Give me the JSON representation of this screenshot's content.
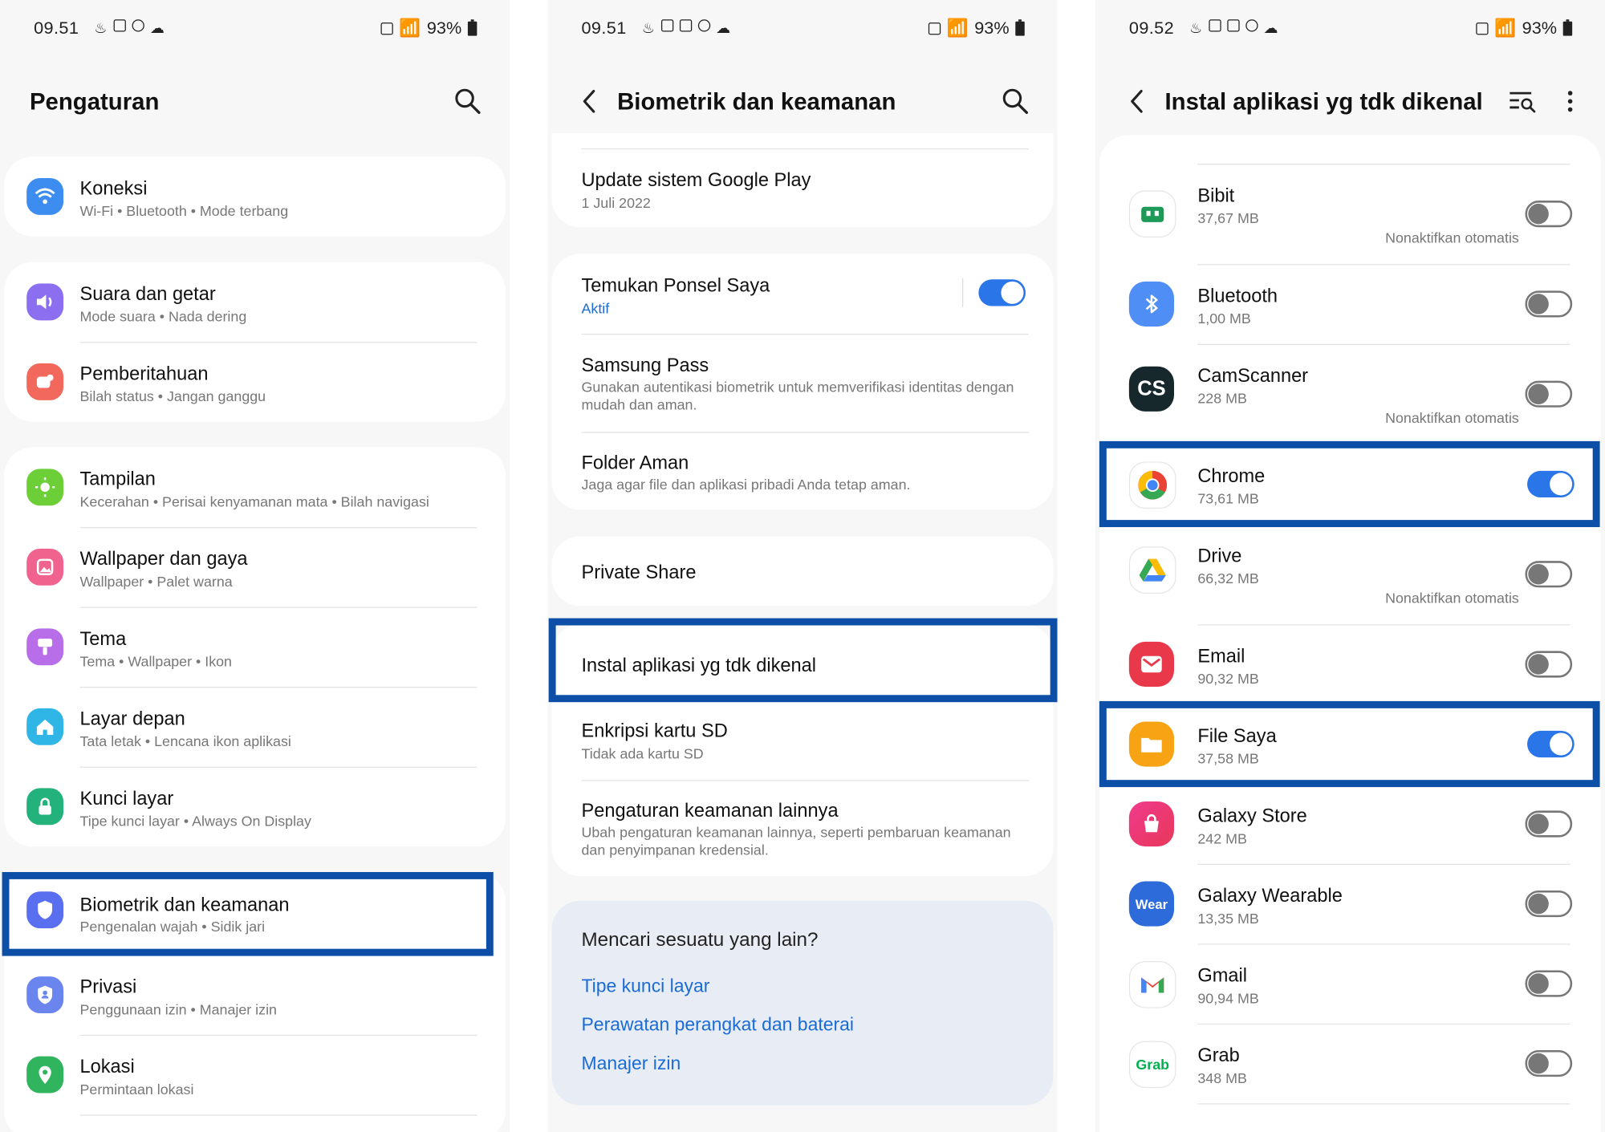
{
  "status": {
    "p1_time": "09.51",
    "p2_time": "09.51",
    "p3_time": "09.52",
    "battery": "93%"
  },
  "panel1": {
    "title": "Pengaturan",
    "items": [
      {
        "title": "Koneksi",
        "sub": "Wi-Fi  •  Bluetooth  •  Mode terbang",
        "color": "#3d8cf0"
      },
      {
        "title": "Suara dan getar",
        "sub": "Mode suara  •  Nada dering",
        "color": "#8b6ff0"
      },
      {
        "title": "Pemberitahuan",
        "sub": "Bilah status  •  Jangan ganggu",
        "color": "#f2685c"
      },
      {
        "title": "Tampilan",
        "sub": "Kecerahan  •  Perisai kenyamanan mata  •  Bilah navigasi",
        "color": "#6ccf38"
      },
      {
        "title": "Wallpaper dan gaya",
        "sub": "Wallpaper  •  Palet warna",
        "color": "#f0638e"
      },
      {
        "title": "Tema",
        "sub": "Tema  •  Wallpaper  •  Ikon",
        "color": "#b86ee8"
      },
      {
        "title": "Layar depan",
        "sub": "Tata letak  •  Lencana ikon aplikasi",
        "color": "#2fb5e6"
      },
      {
        "title": "Kunci layar",
        "sub": "Tipe kunci layar  •  Always On Display",
        "color": "#23b27c"
      },
      {
        "title": "Biometrik dan keamanan",
        "sub": "Pengenalan wajah  •  Sidik jari",
        "color": "#5a6ff0"
      },
      {
        "title": "Privasi",
        "sub": "Penggunaan izin  •  Manajer izin",
        "color": "#6a86ee"
      },
      {
        "title": "Lokasi",
        "sub": "Permintaan lokasi",
        "color": "#31b45e"
      }
    ]
  },
  "panel2": {
    "title": "Biometrik dan keamanan",
    "items": [
      {
        "title": "Update sistem Google Play",
        "sub": "1 Juli 2022"
      },
      {
        "title": "Temukan Ponsel Saya",
        "sub": "Aktif"
      },
      {
        "title": "Samsung Pass",
        "sub": "Gunakan autentikasi biometrik untuk memverifikasi identitas dengan mudah dan aman."
      },
      {
        "title": "Folder Aman",
        "sub": "Jaga agar file dan aplikasi pribadi Anda tetap aman."
      },
      {
        "title": "Private Share",
        "sub": ""
      },
      {
        "title": "Instal aplikasi yg tdk dikenal",
        "sub": ""
      },
      {
        "title": "Enkripsi kartu SD",
        "sub": "Tidak ada kartu SD"
      },
      {
        "title": "Pengaturan keamanan lainnya",
        "sub": "Ubah pengaturan keamanan lainnya, seperti pembaruan keamanan dan penyimpanan kredensial."
      }
    ],
    "suggest": {
      "heading": "Mencari sesuatu yang lain?",
      "links": [
        "Tipe kunci layar",
        "Perawatan perangkat dan baterai",
        "Manajer izin"
      ]
    }
  },
  "panel3": {
    "title": "Instal aplikasi yg tdk dikenal",
    "apps": [
      {
        "name": "Bibit",
        "size": "37,67 MB",
        "note": "Nonaktifkan otomatis",
        "enabled": false
      },
      {
        "name": "Bluetooth",
        "size": "1,00 MB",
        "note": "",
        "enabled": false
      },
      {
        "name": "CamScanner",
        "size": "228 MB",
        "note": "Nonaktifkan otomatis",
        "enabled": false
      },
      {
        "name": "Chrome",
        "size": "73,61 MB",
        "note": "",
        "enabled": true
      },
      {
        "name": "Drive",
        "size": "66,32 MB",
        "note": "Nonaktifkan otomatis",
        "enabled": false
      },
      {
        "name": "Email",
        "size": "90,32 MB",
        "note": "",
        "enabled": false
      },
      {
        "name": "File Saya",
        "size": "37,58 MB",
        "note": "",
        "enabled": true
      },
      {
        "name": "Galaxy Store",
        "size": "242 MB",
        "note": "",
        "enabled": false
      },
      {
        "name": "Galaxy Wearable",
        "size": "13,35 MB",
        "note": "",
        "enabled": false
      },
      {
        "name": "Gmail",
        "size": "90,94 MB",
        "note": "",
        "enabled": false
      },
      {
        "name": "Grab",
        "size": "348 MB",
        "note": "",
        "enabled": false
      }
    ],
    "icon_text": {
      "camscanner": "CS",
      "wear": "Wear",
      "grab": "Grab"
    }
  }
}
